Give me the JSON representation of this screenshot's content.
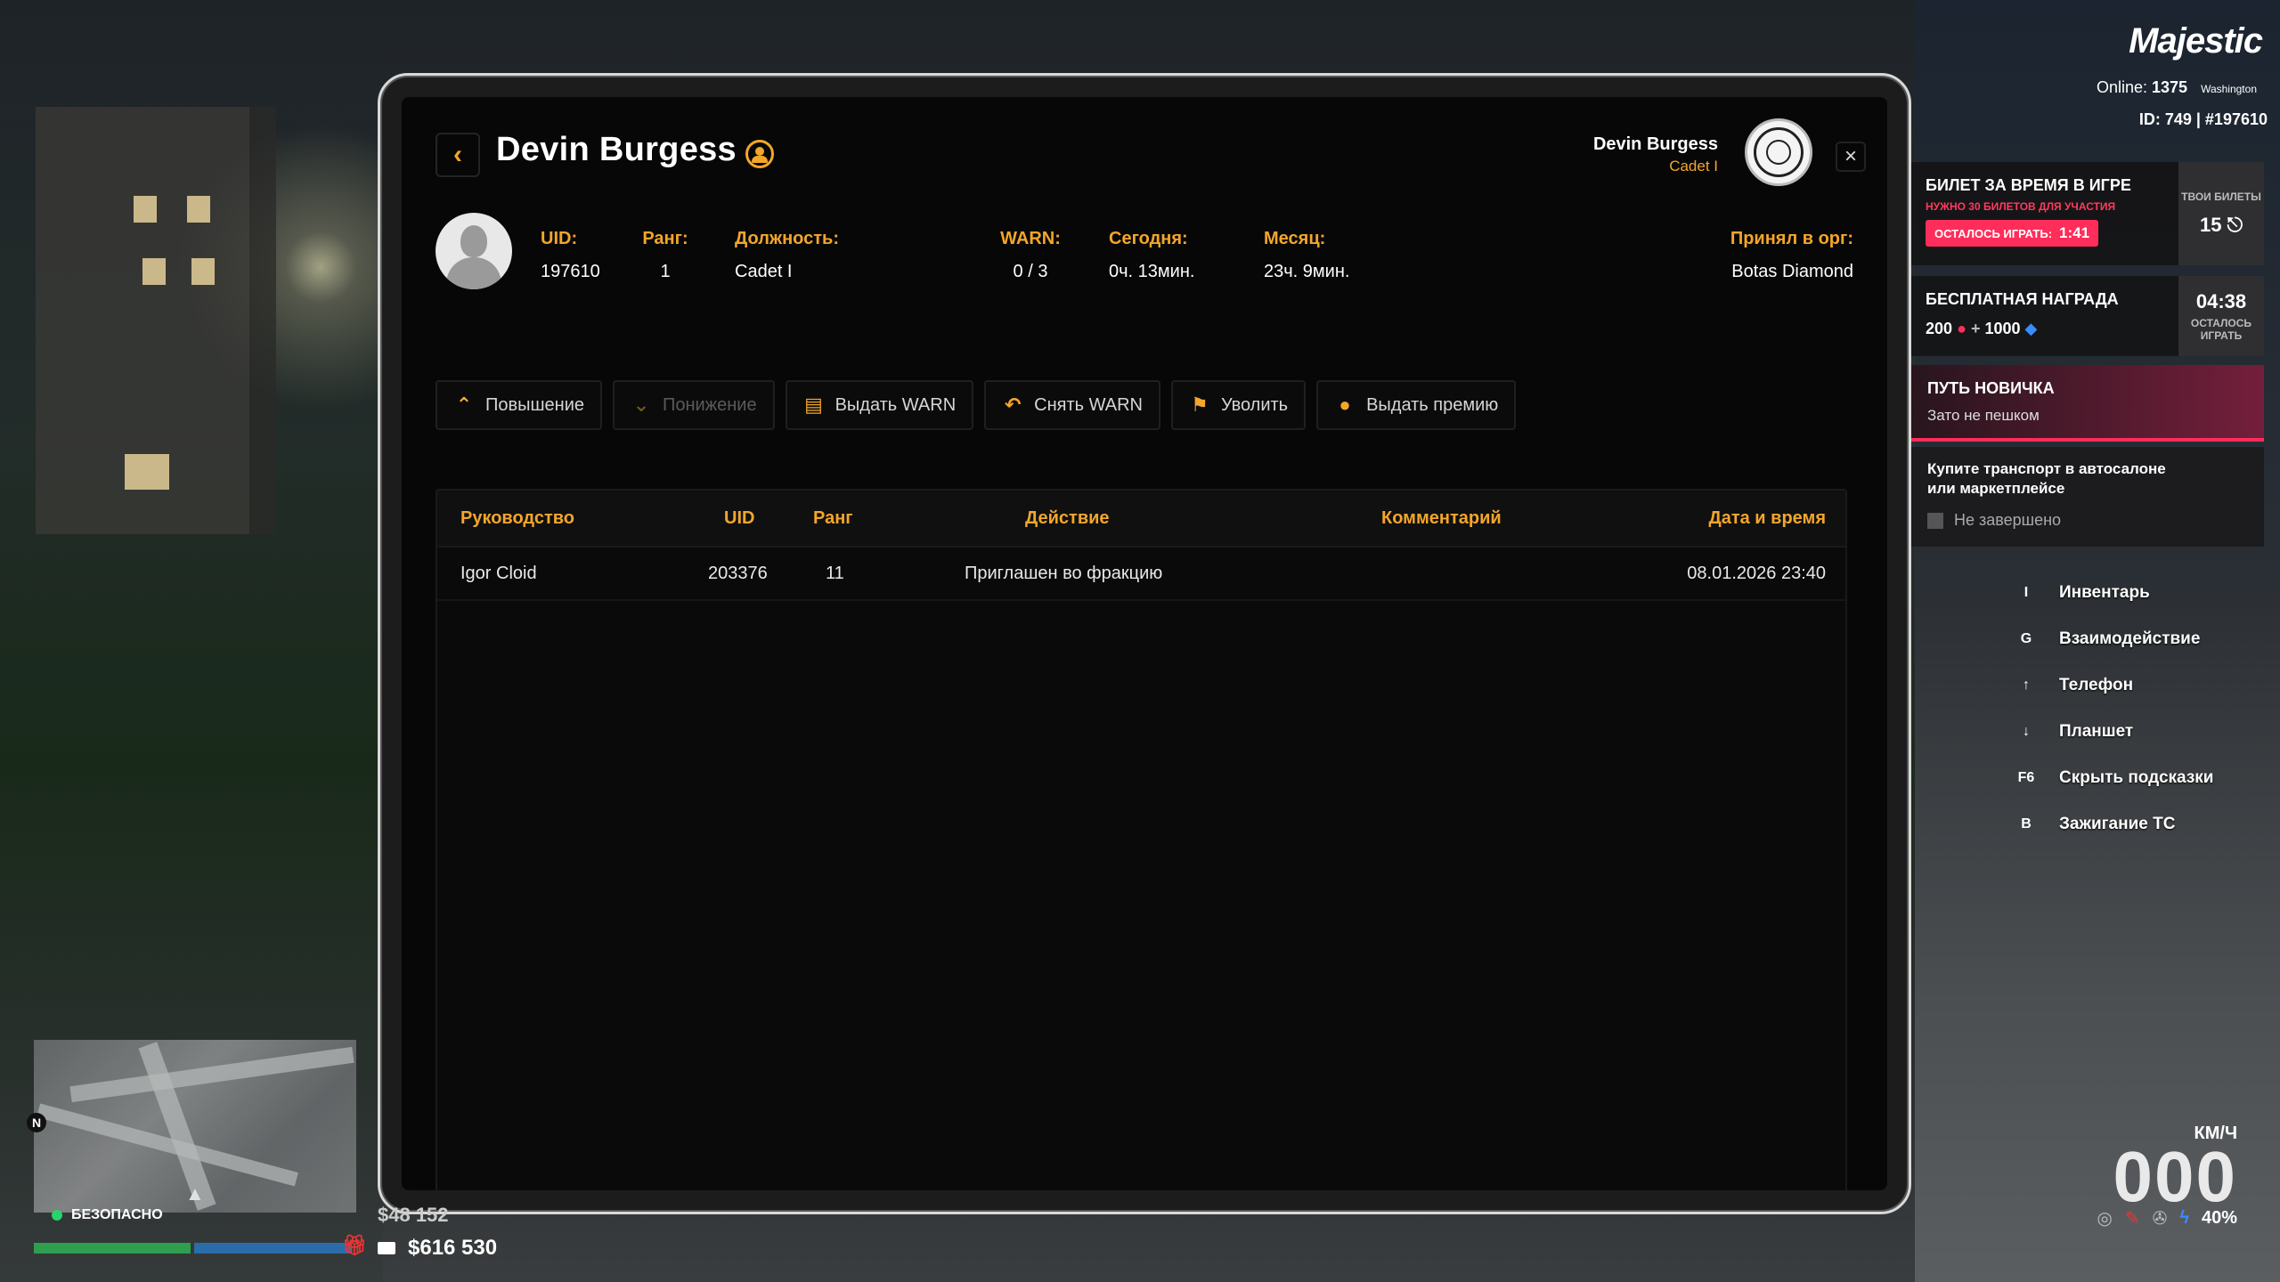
{
  "header": {
    "title": "Devin Burgess",
    "user_name": "Devin Burgess",
    "user_rank": "Cadet I",
    "back_icon": "chevron-left-icon",
    "close_icon": "close-icon"
  },
  "profile": {
    "uid_label": "UID:",
    "uid_value": "197610",
    "rank_label": "Ранг:",
    "rank_value": "1",
    "position_label": "Должность:",
    "position_value": "Cadet I",
    "warn_label": "WARN:",
    "warn_value": "0 / 3",
    "today_label": "Сегодня:",
    "today_value": "0ч. 13мин.",
    "month_label": "Месяц:",
    "month_value": "23ч. 9мин.",
    "accepted_label": "Принял в орг:",
    "accepted_value": "Botas Diamond"
  },
  "actions": [
    {
      "label": "Повышение",
      "icon": "chevron-up-icon",
      "enabled": true
    },
    {
      "label": "Понижение",
      "icon": "chevron-down-icon",
      "enabled": false
    },
    {
      "label": "Выдать WARN",
      "icon": "warn-doc-icon",
      "enabled": true
    },
    {
      "label": "Снять WARN",
      "icon": "undo-icon",
      "enabled": true
    },
    {
      "label": "Уволить",
      "icon": "fire-icon",
      "enabled": true
    },
    {
      "label": "Выдать премию",
      "icon": "coin-icon",
      "enabled": true
    }
  ],
  "table": {
    "headers": [
      "Руководство",
      "UID",
      "Ранг",
      "Действие",
      "Комментарий",
      "Дата и время"
    ],
    "rows": [
      [
        "Igor Cloid",
        "203376",
        "11",
        "Приглашен во фракцию",
        "",
        "08.01.2026 23:40"
      ]
    ]
  },
  "hud": {
    "brand": "Majestic",
    "online_label": "Online:",
    "online_count": "1375",
    "server": "Washington",
    "id_line": "ID: 749 | #197610",
    "ticket": {
      "title": "БИЛЕТ ЗА ВРЕМЯ В ИГРЕ",
      "subtitle": "НУЖНО 30 БИЛЕТОВ ДЛЯ УЧАСТИЯ",
      "badge_label": "ОСТАЛОСЬ ИГРАТЬ:",
      "badge_time": "1:41",
      "side_label": "ТВОИ БИЛЕТЫ",
      "side_count": "15"
    },
    "reward": {
      "title": "БЕСПЛАТНАЯ НАГРАДА",
      "amount1": "200",
      "plus": "+",
      "amount2": "1000",
      "side_time": "04:38",
      "side_label": "ОСТАЛОСЬ ИГРАТЬ"
    },
    "path": {
      "title": "ПУТЬ НОВИЧКА",
      "subtitle": "Зато не пешком",
      "task": "Купите транспорт в автосалоне или маркетплейсе",
      "status": "Не завершено"
    },
    "hints": [
      {
        "key": "I",
        "label": "Инвентарь"
      },
      {
        "key": "G",
        "label": "Взаимодействие"
      },
      {
        "key": "↑",
        "label": "Телефон"
      },
      {
        "key": "↓",
        "label": "Планшет"
      },
      {
        "key": "F6",
        "label": "Скрыть подсказки"
      },
      {
        "key": "B",
        "label": "Зажигание ТС"
      }
    ],
    "speed_unit": "КМ/Ч",
    "speed": "000",
    "fuel": "40%",
    "compass": "N",
    "zone": "БЕЗОПАСНО",
    "money_cash": "$48 152",
    "money_bank": "$616 530"
  }
}
